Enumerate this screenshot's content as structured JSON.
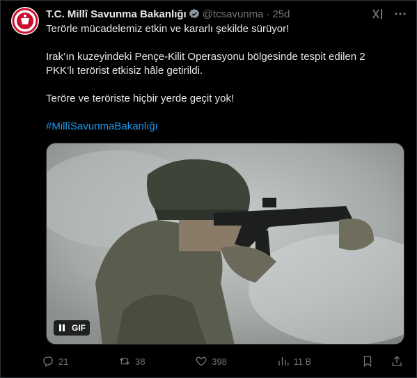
{
  "account": {
    "name": "T.C. Millî Savunma Bakanlığı",
    "handle": "@tcsavunma",
    "separator": "·",
    "time": "25d"
  },
  "tweet": {
    "line1": "Terörle mücadelemiz etkin ve kararlı şekilde sürüyor!",
    "line2": "Irak’ın kuzeyindeki Pençe-Kilit Operasyonu bölgesinde tespit edilen 2 PKK’lı terörist etkisiz hâle getirildi.",
    "line3": "Teröre ve teröriste hiçbir yerde geçit yok!",
    "hashtag": "#MillîSavunmaBakanlığı"
  },
  "media": {
    "type_label": "GIF"
  },
  "actions": {
    "replies": "21",
    "retweets": "38",
    "likes": "398",
    "views": "11 B"
  },
  "colors": {
    "accent": "#1d9bf0",
    "muted": "#71767b",
    "background": "#000000",
    "logo_red": "#c8102e"
  },
  "icons": [
    "verified-badge-icon",
    "grok-icon",
    "more-icon",
    "pause-icon",
    "reply-icon",
    "retweet-icon",
    "like-icon",
    "views-icon",
    "bookmark-icon",
    "share-icon"
  ]
}
